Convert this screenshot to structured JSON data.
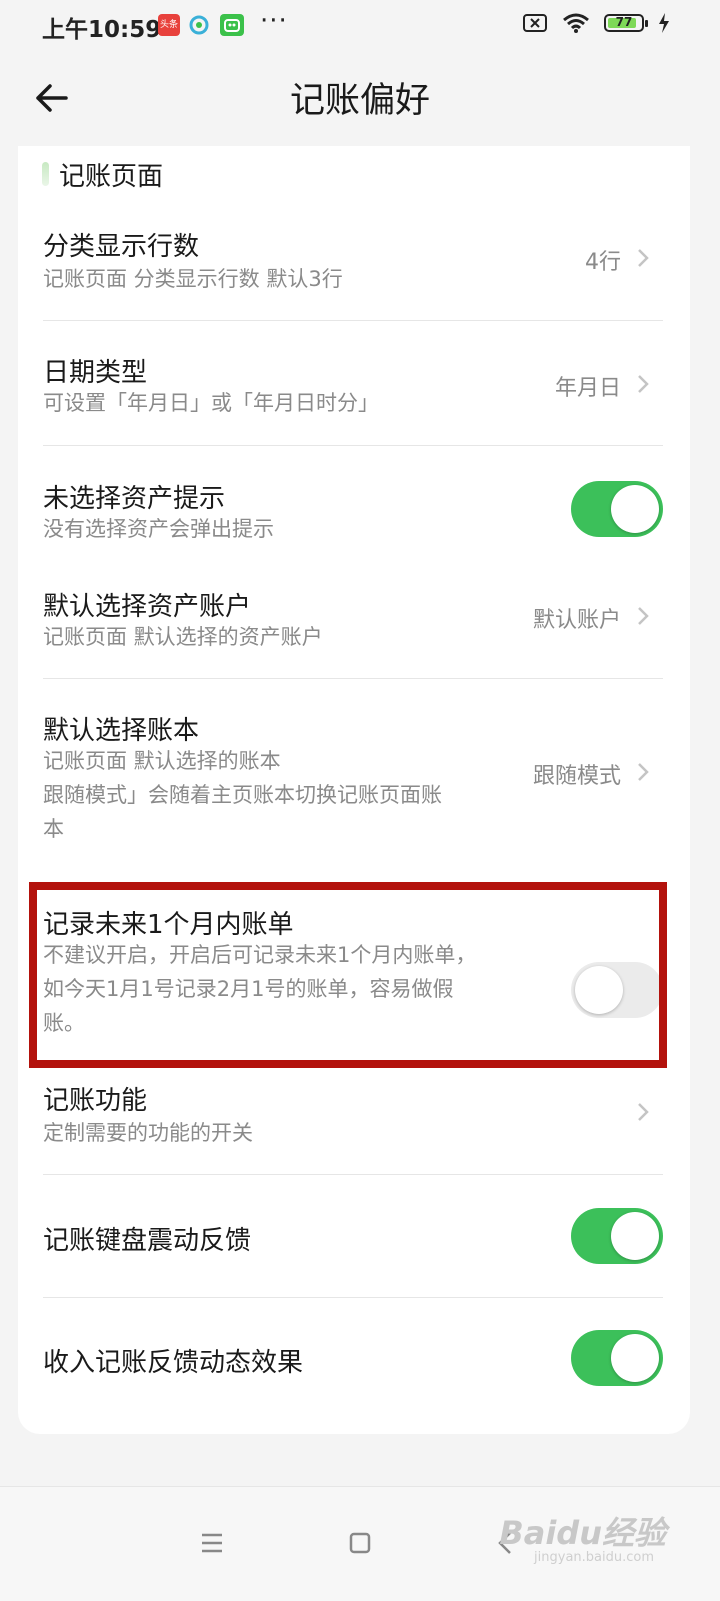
{
  "status_bar": {
    "time": "上午10:59",
    "app_badge_news": "头条",
    "more": "···",
    "battery_level": "77"
  },
  "header": {
    "title": "记账偏好"
  },
  "section": {
    "title": "记账页面"
  },
  "settings": [
    {
      "title": "分类显示行数",
      "desc": "记账页面 分类显示行数 默认3行",
      "value": "4行"
    },
    {
      "title": "日期类型",
      "desc": "可设置「年月日」或「年月日时分」",
      "value": "年月日"
    },
    {
      "title": "未选择资产提示",
      "desc": "没有选择资产会弹出提示",
      "toggle": "on"
    },
    {
      "title": "默认选择资产账户",
      "desc": "记账页面 默认选择的资产账户",
      "value": "默认账户"
    },
    {
      "title": "默认选择账本",
      "desc_lines": [
        "记账页面 默认选择的账本",
        "跟随模式」会随着主页账本切换记账页面账",
        "本"
      ],
      "value": "跟随模式"
    },
    {
      "title": "记录未来1个月内账单",
      "desc_lines": [
        "不建议开启，开启后可记录未来1个月内账单，",
        "如今天1月1号记录2月1号的账单，容易做假",
        "账。"
      ],
      "toggle": "off"
    },
    {
      "title": "记账功能",
      "desc": "定制需要的功能的开关"
    },
    {
      "title": "记账键盘震动反馈",
      "toggle": "on"
    },
    {
      "title": "收入记账反馈动态效果",
      "toggle": "on"
    }
  ],
  "watermark": {
    "brand": "Baidu经验",
    "url": "jingyan.baidu.com"
  },
  "colors": {
    "toggle_on": "#3cc05a",
    "highlight": "#b3120c"
  }
}
